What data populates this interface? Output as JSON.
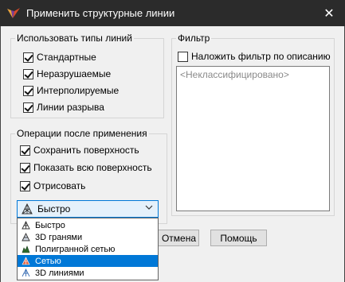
{
  "window": {
    "title": "Применить структурные линии",
    "close_glyph": "✕"
  },
  "line_types": {
    "legend": "Использовать типы линий",
    "items": [
      {
        "label": "Стандартные",
        "checked": true
      },
      {
        "label": "Неразрушаемые",
        "checked": true
      },
      {
        "label": "Интерполируемые",
        "checked": true
      },
      {
        "label": "Линии разрыва",
        "checked": true
      }
    ]
  },
  "post_ops": {
    "legend": "Операции после применения",
    "items": [
      {
        "label": "Сохранить поверхность",
        "checked": true
      },
      {
        "label": "Показать всю поверхность",
        "checked": true
      },
      {
        "label": "Отрисовать",
        "checked": true
      }
    ]
  },
  "filter": {
    "legend": "Фильтр",
    "checkbox_label": "Наложить фильтр по описанию",
    "checked": false,
    "list_items": [
      "<Неклассифицировано>"
    ]
  },
  "render_mode": {
    "selected": "Быстро",
    "options": [
      "Быстро",
      "3D гранями",
      "Полигранной сетью",
      "Сетью",
      "3D линиями"
    ],
    "highlighted_index": 3
  },
  "buttons": {
    "cancel": "Отмена",
    "help": "Помощь"
  }
}
